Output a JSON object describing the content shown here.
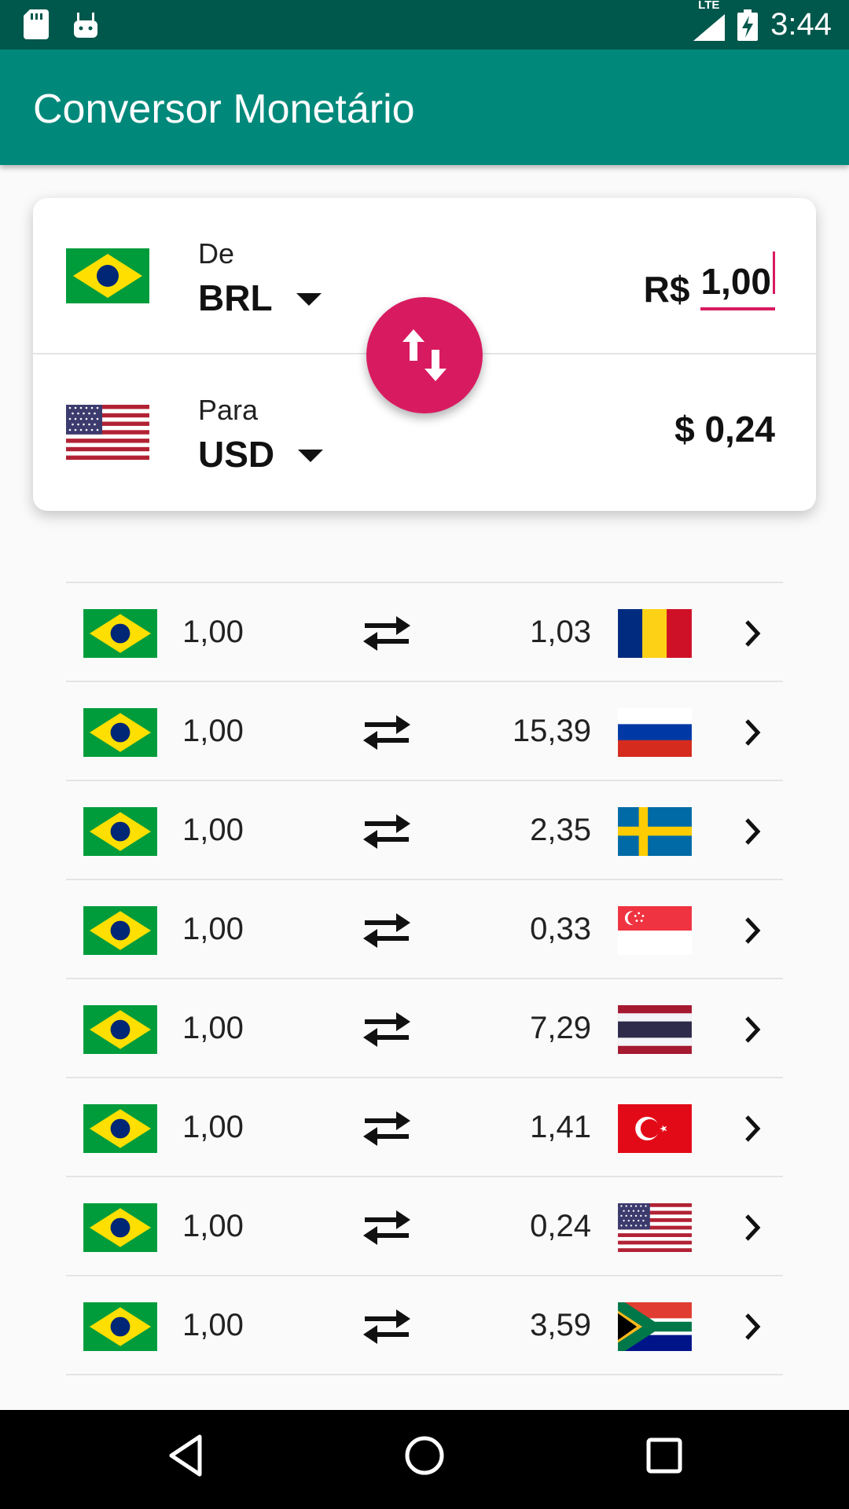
{
  "status_bar": {
    "time": "3:44",
    "network": "LTE"
  },
  "app_bar": {
    "title": "Conversor Monetário"
  },
  "converter": {
    "from": {
      "label": "De",
      "code": "BRL",
      "symbol": "R$",
      "amount": "1,00",
      "flag_icon": "brazil-flag-icon"
    },
    "to": {
      "label": "Para",
      "code": "USD",
      "result": "$ 0,24",
      "flag_icon": "usa-flag-icon"
    },
    "swap_icon": "swap-vertical-icon"
  },
  "list": {
    "rows": [
      {
        "from": "1,00",
        "to": "1,03",
        "flag": "romania-flag-icon"
      },
      {
        "from": "1,00",
        "to": "15,39",
        "flag": "russia-flag-icon"
      },
      {
        "from": "1,00",
        "to": "2,35",
        "flag": "sweden-flag-icon"
      },
      {
        "from": "1,00",
        "to": "0,33",
        "flag": "singapore-flag-icon"
      },
      {
        "from": "1,00",
        "to": "7,29",
        "flag": "thailand-flag-icon"
      },
      {
        "from": "1,00",
        "to": "1,41",
        "flag": "turkey-flag-icon"
      },
      {
        "from": "1,00",
        "to": "0,24",
        "flag": "usa-flag-icon"
      },
      {
        "from": "1,00",
        "to": "3,59",
        "flag": "south-africa-flag-icon"
      }
    ]
  },
  "colors": {
    "primary": "#00897b",
    "primary_dark": "#00574b",
    "accent": "#d81b60"
  }
}
